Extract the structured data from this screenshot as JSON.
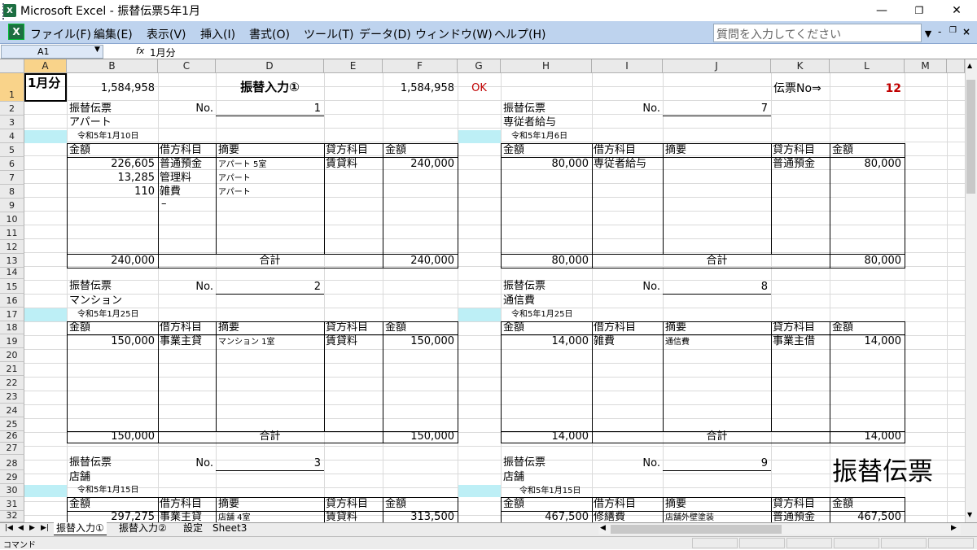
{
  "window": {
    "title": "Microsoft Excel - 振替伝票5年1月",
    "icon_letter": "X",
    "min": "—",
    "max": "❐",
    "close": "✕"
  },
  "menu": {
    "items": [
      "ファイル(F)",
      "編集(E)",
      "表示(V)",
      "挿入(I)",
      "書式(O)",
      "ツール(T)",
      "データ(D)",
      "ウィンドウ(W)",
      "ヘルプ(H)"
    ],
    "ask_placeholder": "質問を入力してください",
    "mdi_min": "-",
    "mdi_restore": "ₐ",
    "mdi_close": "×"
  },
  "formula_bar": {
    "name_box": "A1",
    "fx": "fx",
    "formula": "1月分"
  },
  "columns": [
    "A",
    "B",
    "C",
    "D",
    "E",
    "F",
    "G",
    "H",
    "I",
    "J",
    "K",
    "L",
    "M"
  ],
  "rows": [
    "1",
    "2",
    "3",
    "4",
    "5",
    "6",
    "7",
    "8",
    "9",
    "10",
    "11",
    "12",
    "13",
    "14",
    "15",
    "16",
    "17",
    "18",
    "19",
    "20",
    "21",
    "22",
    "23",
    "24",
    "25",
    "26",
    "27",
    "28",
    "29",
    "30",
    "31",
    "32"
  ],
  "top": {
    "a1": "1月分",
    "b1": "1,584,958",
    "d1": "振替入力①",
    "f1": "1,584,958",
    "g1": "OK",
    "k1": "伝票No⇒",
    "l1": "12"
  },
  "labels": {
    "voucher": "振替伝票",
    "no": "No.",
    "amount": "金額",
    "debit": "借方科目",
    "desc": "摘要",
    "credit": "貸方科目",
    "total": "合計"
  },
  "vouchers": {
    "v1": {
      "no": "1",
      "name": "アパート",
      "date": "令和5年1月10日",
      "lines": [
        {
          "amt": "226,605",
          "debit": "普通預金",
          "desc": "アパート 5室",
          "credit": "賃貸料",
          "camt": "240,000"
        },
        {
          "amt": "13,285",
          "debit": "管理料",
          "desc": "アパート",
          "credit": "",
          "camt": ""
        },
        {
          "amt": "110",
          "debit": "雑費",
          "desc": "アパート",
          "credit": "",
          "camt": ""
        },
        {
          "amt": "",
          "debit": "–",
          "desc": "",
          "credit": "",
          "camt": ""
        }
      ],
      "total_left": "240,000",
      "total_right": "240,000"
    },
    "v2": {
      "no": "2",
      "name": "マンション",
      "date": "令和5年1月25日",
      "lines": [
        {
          "amt": "150,000",
          "debit": "事業主貸",
          "desc": "マンション 1室",
          "credit": "賃貸料",
          "camt": "150,000"
        }
      ],
      "total_left": "150,000",
      "total_right": "150,000"
    },
    "v3": {
      "no": "3",
      "name": "店舗",
      "date": "令和5年1月15日",
      "lines": [
        {
          "amt": "297,275",
          "debit": "事業主貸",
          "desc": "店舗 4室",
          "credit": "賃貸料",
          "camt": "313,500"
        }
      ]
    },
    "v7": {
      "no": "7",
      "name": "専従者給与",
      "date": "令和5年1月6日",
      "lines": [
        {
          "amt": "80,000",
          "debit": "専従者給与",
          "desc": "",
          "credit": "普通預金",
          "camt": "80,000"
        }
      ],
      "total_left": "80,000",
      "total_right": "80,000"
    },
    "v8": {
      "no": "8",
      "name": "通信費",
      "date": "令和5年1月25日",
      "lines": [
        {
          "amt": "14,000",
          "debit": "雑費",
          "desc": "通信費",
          "credit": "事業主借",
          "camt": "14,000"
        }
      ],
      "total_left": "14,000",
      "total_right": "14,000"
    },
    "v9": {
      "no": "9",
      "name": "店舗",
      "date": "令和5年1月15日",
      "lines": [
        {
          "amt": "467,500",
          "debit": "修繕費",
          "desc": "店舗外壁塗装",
          "credit": "普通預金",
          "camt": "467,500"
        }
      ]
    }
  },
  "big_title": "振替伝票",
  "tabs": [
    "振替入力①",
    "振替入力②",
    "設定",
    "Sheet3"
  ],
  "status": "コマンド",
  "colors": {
    "menubar": "#bed3ee",
    "selected_header": "#f9d38a",
    "cyan_fill": "#bdeff6",
    "ok_red": "#c00000"
  }
}
